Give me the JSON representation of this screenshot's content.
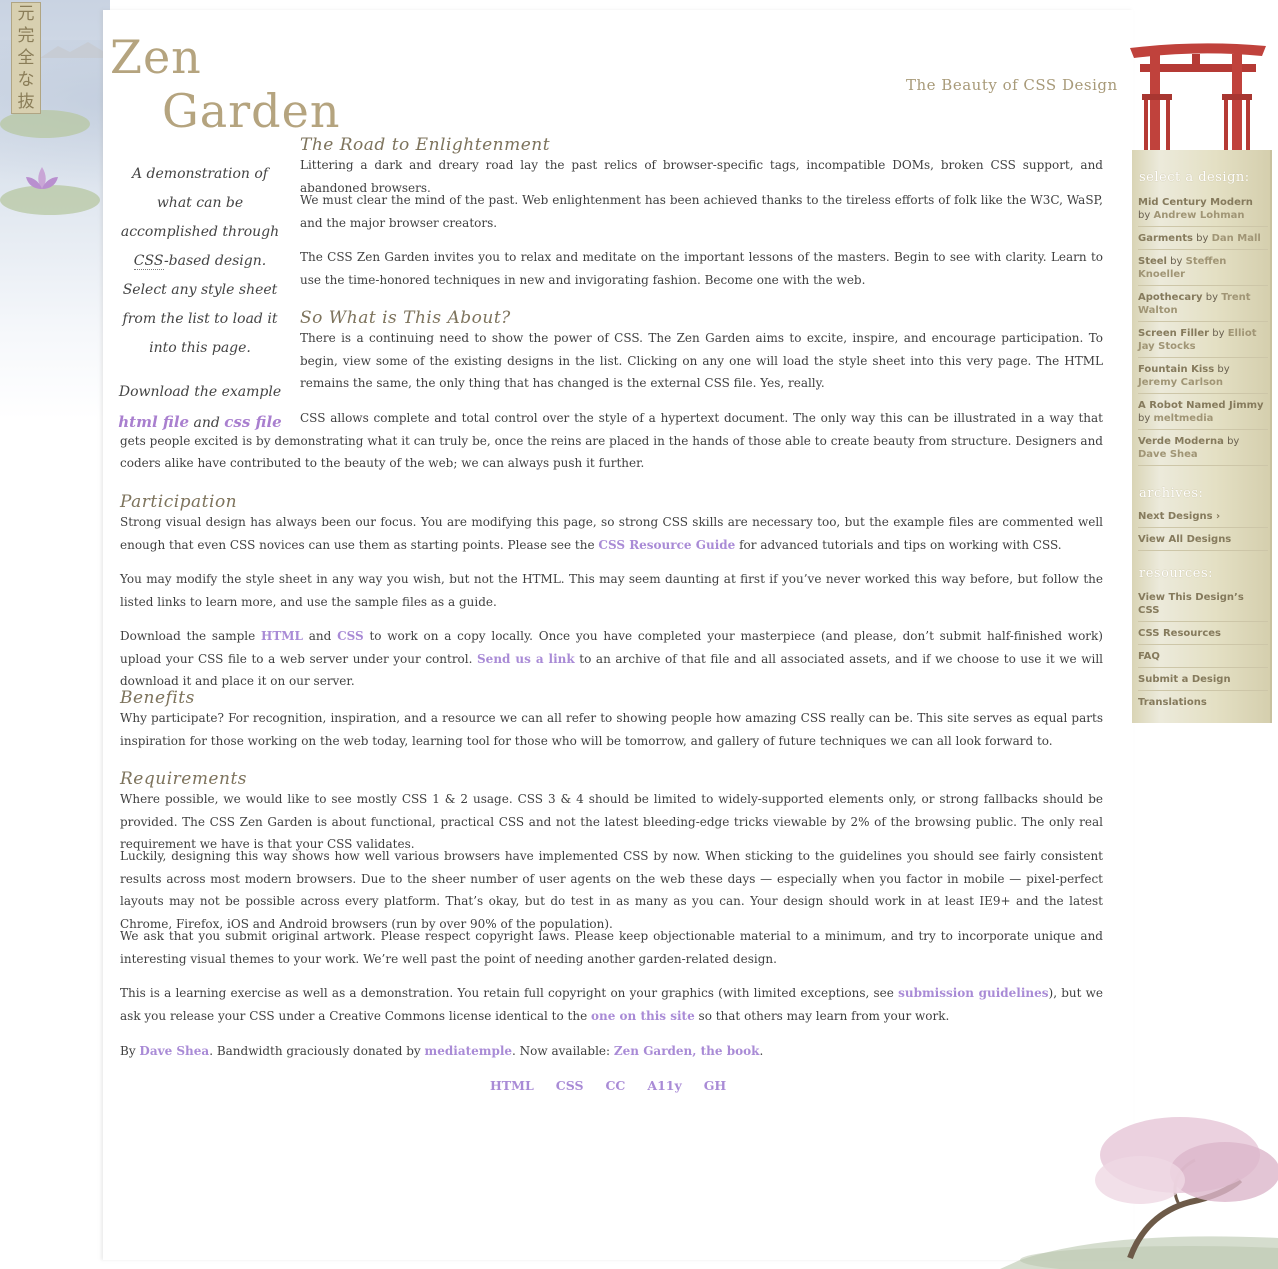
{
  "header": {
    "scroll_chars": [
      "元",
      "完",
      "全",
      "な",
      "抜"
    ],
    "logo_line1": "Zen",
    "logo_line2": "Garden",
    "tagline": "The Beauty of CSS Design"
  },
  "intro": {
    "part1": "A demonstration of what can be accomplished through ",
    "abbr": "CSS",
    "part2": "-based design. Select any style sheet from the list to load it into this page.",
    "download_prefix": "Download the example",
    "html_link": "html file",
    "and": "and",
    "css_link": "css file"
  },
  "sections": {
    "road": {
      "title": "The Road to Enlightenment",
      "p1": "Littering a dark and dreary road lay the past relics of browser-specific tags, incompatible DOMs, broken CSS support, and abandoned browsers.",
      "p2": "We must clear the mind of the past. Web enlightenment has been achieved thanks to the tireless efforts of folk like the W3C, WaSP, and the major browser creators.",
      "p3": "The CSS Zen Garden invites you to relax and meditate on the important lessons of the masters. Begin to see with clarity. Learn to use the time-honored techniques in new and invigorating fashion. Become one with the web."
    },
    "about": {
      "title": "So What is This About?",
      "p1": "There is a continuing need to show the power of CSS. The Zen Garden aims to excite, inspire, and encourage participation. To begin, view some of the existing designs in the list. Clicking on any one will load the style sheet into this very page. The HTML remains the same, the only thing that has changed is the external CSS file. Yes, really.",
      "p2": "CSS allows complete and total control over the style of a hypertext document. The only way this can be illustrated in a way that gets people excited is by demonstrating what it can truly be, once the reins are placed in the hands of those able to create beauty from structure. Designers and coders alike have contributed to the beauty of the web; we can always push it further."
    },
    "participation": {
      "title": "Participation",
      "p1a": "Strong visual design has always been our focus. You are modifying this page, so strong CSS skills are necessary too, but the example files are commented well enough that even CSS novices can use them as starting points. Please see the ",
      "p1_link": "CSS Resource Guide",
      "p1b": " for advanced tutorials and tips on working with CSS.",
      "p2": "You may modify the style sheet in any way you wish, but not the HTML. This may seem daunting at first if you’ve never worked this way before, but follow the listed links to learn more, and use the sample files as a guide.",
      "p3a": "Download the sample ",
      "p3_html": "HTML",
      "p3_and": " and ",
      "p3_css": "CSS",
      "p3b": " to work on a copy locally. Once you have completed your masterpiece (and please, don’t submit half-finished work) upload your CSS file to a web server under your control. ",
      "p3_link": "Send us a link",
      "p3c": " to an archive of that file and all associated assets, and if we choose to use it we will download it and place it on our server."
    },
    "benefits": {
      "title": "Benefits",
      "p1": "Why participate? For recognition, inspiration, and a resource we can all refer to showing people how amazing CSS really can be. This site serves as equal parts inspiration for those working on the web today, learning tool for those who will be tomorrow, and gallery of future techniques we can all look forward to."
    },
    "requirements": {
      "title": "Requirements",
      "p1": "Where possible, we would like to see mostly CSS 1 & 2 usage. CSS 3 & 4 should be limited to widely-supported elements only, or strong fallbacks should be provided. The CSS Zen Garden is about functional, practical CSS and not the latest bleeding-edge tricks viewable by 2% of the browsing public. The only real requirement we have is that your CSS validates.",
      "p2": "Luckily, designing this way shows how well various browsers have implemented CSS by now. When sticking to the guidelines you should see fairly consistent results across most modern browsers. Due to the sheer number of user agents on the web these days — especially when you factor in mobile — pixel-perfect layouts may not be possible across every platform. That’s okay, but do test in as many as you can. Your design should work in at least IE9+ and the latest Chrome, Firefox, iOS and Android browsers (run by over 90% of the population).",
      "p3": "We ask that you submit original artwork. Please respect copyright laws. Please keep objectionable material to a minimum, and try to incorporate unique and interesting visual themes to your work. We’re well past the point of needing another garden-related design.",
      "p4a": "This is a learning exercise as well as a demonstration. You retain full copyright on your graphics (with limited exceptions, see ",
      "p4_link1": "submission guidelines",
      "p4b": "), but we ask you release your CSS under a Creative Commons license identical to the ",
      "p4_link2": "one on this site",
      "p4c": " so that others may learn from your work.",
      "p5a": "By ",
      "p5_link1": "Dave Shea",
      "p5b": ". Bandwidth graciously donated by ",
      "p5_link2": "mediatemple",
      "p5c": ". Now available: ",
      "p5_link3": "Zen Garden, the book",
      "p5d": "."
    }
  },
  "footer_links": [
    "HTML",
    "CSS",
    "CC",
    "A11y",
    "GH"
  ],
  "sidebar": {
    "select_heading": "select a design:",
    "designs": [
      {
        "title": "Mid Century Modern",
        "by": "by",
        "author": "Andrew Lohman"
      },
      {
        "title": "Garments",
        "by": "by",
        "author": "Dan Mall"
      },
      {
        "title": "Steel",
        "by": "by",
        "author": "Steffen Knoeller"
      },
      {
        "title": "Apothecary",
        "by": "by",
        "author": "Trent Walton"
      },
      {
        "title": "Screen Filler",
        "by": "by",
        "author": "Elliot Jay Stocks"
      },
      {
        "title": "Fountain Kiss",
        "by": "by",
        "author": "Jeremy Carlson"
      },
      {
        "title": "A Robot Named Jimmy",
        "by": "by",
        "author": "meltmedia"
      },
      {
        "title": "Verde Moderna",
        "by": "by",
        "author": "Dave Shea"
      }
    ],
    "archives_heading": "archives:",
    "archives": [
      "Next Designs ›",
      "View All Designs"
    ],
    "resources_heading": "resources:",
    "resources": [
      "View This Design’s CSS",
      "CSS Resources",
      "FAQ",
      "Submit a Design",
      "Translations"
    ]
  },
  "colors": {
    "link": "#a98bd6",
    "heading": "#7d735c",
    "logo": "#b5a47f",
    "sidebar_bg": "#e6e2c8",
    "torii_red": "#c0423c"
  }
}
